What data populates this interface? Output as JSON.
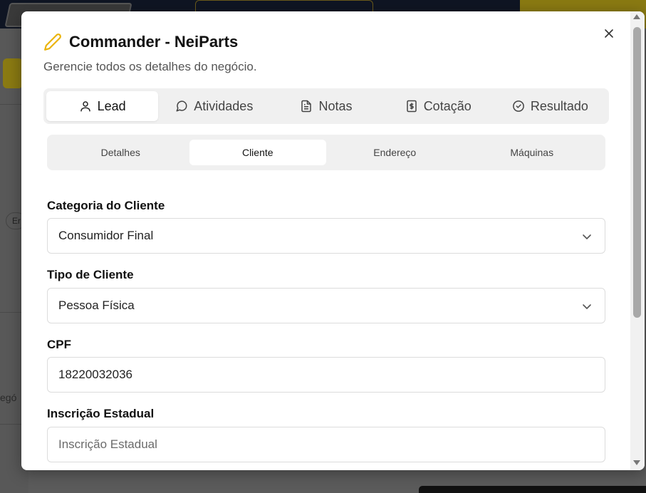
{
  "background": {
    "partial_text": "egó",
    "chip_text": "Er"
  },
  "modal": {
    "title": "Commander - NeiParts",
    "subtitle": "Gerencie todos os detalhes do negócio.",
    "icon": "pencil-icon",
    "accent_color": "#eab308"
  },
  "main_tabs": [
    {
      "label": "Lead",
      "icon": "user-icon",
      "active": true
    },
    {
      "label": "Atividades",
      "icon": "message-circle-icon",
      "active": false
    },
    {
      "label": "Notas",
      "icon": "file-text-icon",
      "active": false
    },
    {
      "label": "Cotação",
      "icon": "dollar-doc-icon",
      "active": false
    },
    {
      "label": "Resultado",
      "icon": "check-circle-icon",
      "active": false
    }
  ],
  "sub_tabs": [
    {
      "label": "Detalhes",
      "active": false
    },
    {
      "label": "Cliente",
      "active": true
    },
    {
      "label": "Endereço",
      "active": false
    },
    {
      "label": "Máquinas",
      "active": false
    }
  ],
  "form": {
    "categoria": {
      "label": "Categoria do Cliente",
      "value": "Consumidor Final"
    },
    "tipo": {
      "label": "Tipo de Cliente",
      "value": "Pessoa Física"
    },
    "cpf": {
      "label": "CPF",
      "value": "18220032036"
    },
    "inscricao": {
      "label": "Inscrição Estadual",
      "placeholder": "Inscrição Estadual",
      "value": ""
    }
  }
}
